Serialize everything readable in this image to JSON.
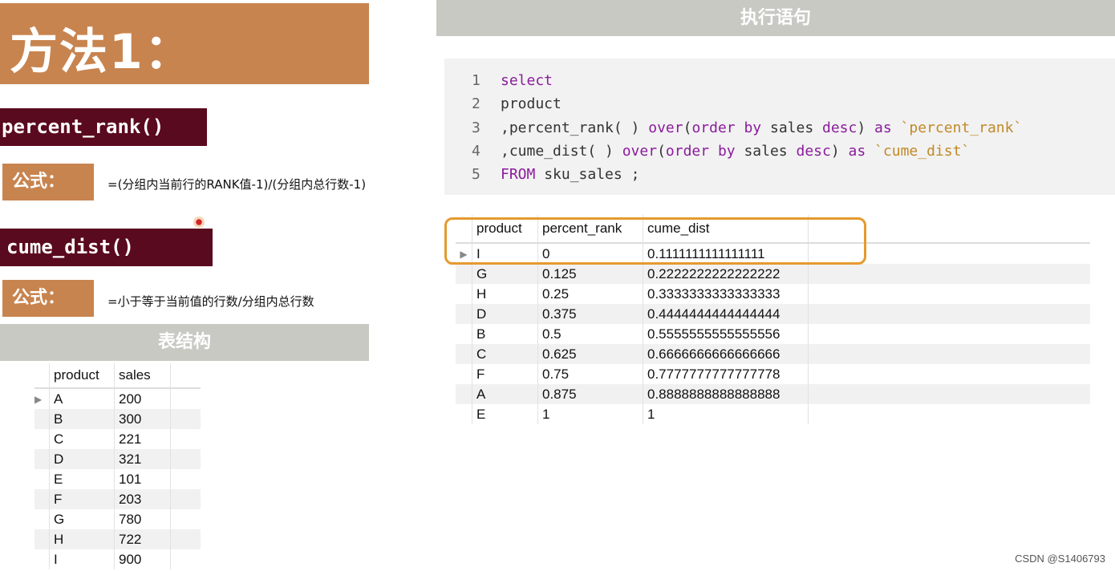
{
  "title": "方法1：",
  "functions": [
    {
      "name": "percent_rank()",
      "formula_label": "公式：",
      "formula": "=(分组内当前行的RANK值-1)/(分组内总行数-1)"
    },
    {
      "name": "cume_dist()",
      "formula_label": "公式：",
      "formula": "=小于等于当前值的行数/分组内总行数"
    }
  ],
  "table_structure": {
    "header": "表结构",
    "columns": [
      "product",
      "sales"
    ],
    "rows": [
      [
        "A",
        "200"
      ],
      [
        "B",
        "300"
      ],
      [
        "C",
        "221"
      ],
      [
        "D",
        "321"
      ],
      [
        "E",
        "101"
      ],
      [
        "F",
        "203"
      ],
      [
        "G",
        "780"
      ],
      [
        "H",
        "722"
      ],
      [
        "I",
        "900"
      ]
    ]
  },
  "exec_header": "执行语句",
  "code": {
    "line_numbers": [
      "1",
      "2",
      "3",
      "4",
      "5"
    ],
    "l1": "select",
    "l2": "product",
    "l3a": ",percent_rank( ) ",
    "l3b": "over",
    "l3c": "(",
    "l3d": "order by",
    "l3e": " sales ",
    "l3f": "desc",
    "l3g": ") ",
    "l3h": "as",
    "l3i": " `percent_rank`",
    "l4a": ",cume_dist( ) ",
    "l4b": "over",
    "l4c": "(",
    "l4d": "order by",
    "l4e": " sales ",
    "l4f": "desc",
    "l4g": ") ",
    "l4h": "as",
    "l4i": " `cume_dist`",
    "l5a": "FROM",
    "l5b": " sku_sales ;"
  },
  "result": {
    "columns": [
      "product",
      "percent_rank",
      "cume_dist"
    ],
    "rows": [
      [
        "I",
        "0",
        "0.1111111111111111"
      ],
      [
        "G",
        "0.125",
        "0.2222222222222222"
      ],
      [
        "H",
        "0.25",
        "0.3333333333333333"
      ],
      [
        "D",
        "0.375",
        "0.4444444444444444"
      ],
      [
        "B",
        "0.5",
        "0.5555555555555556"
      ],
      [
        "C",
        "0.625",
        "0.6666666666666666"
      ],
      [
        "F",
        "0.75",
        "0.7777777777777778"
      ],
      [
        "A",
        "0.875",
        "0.8888888888888888"
      ],
      [
        "E",
        "1",
        "1"
      ]
    ]
  },
  "watermark": "CSDN @S1406793",
  "colors": {
    "accent": "#c8844f",
    "fn_bg": "#5a0a1e",
    "header_gray": "#c9c9c4",
    "highlight": "#e59a2f",
    "keyword": "#8a1c9c",
    "string": "#c08a28"
  }
}
